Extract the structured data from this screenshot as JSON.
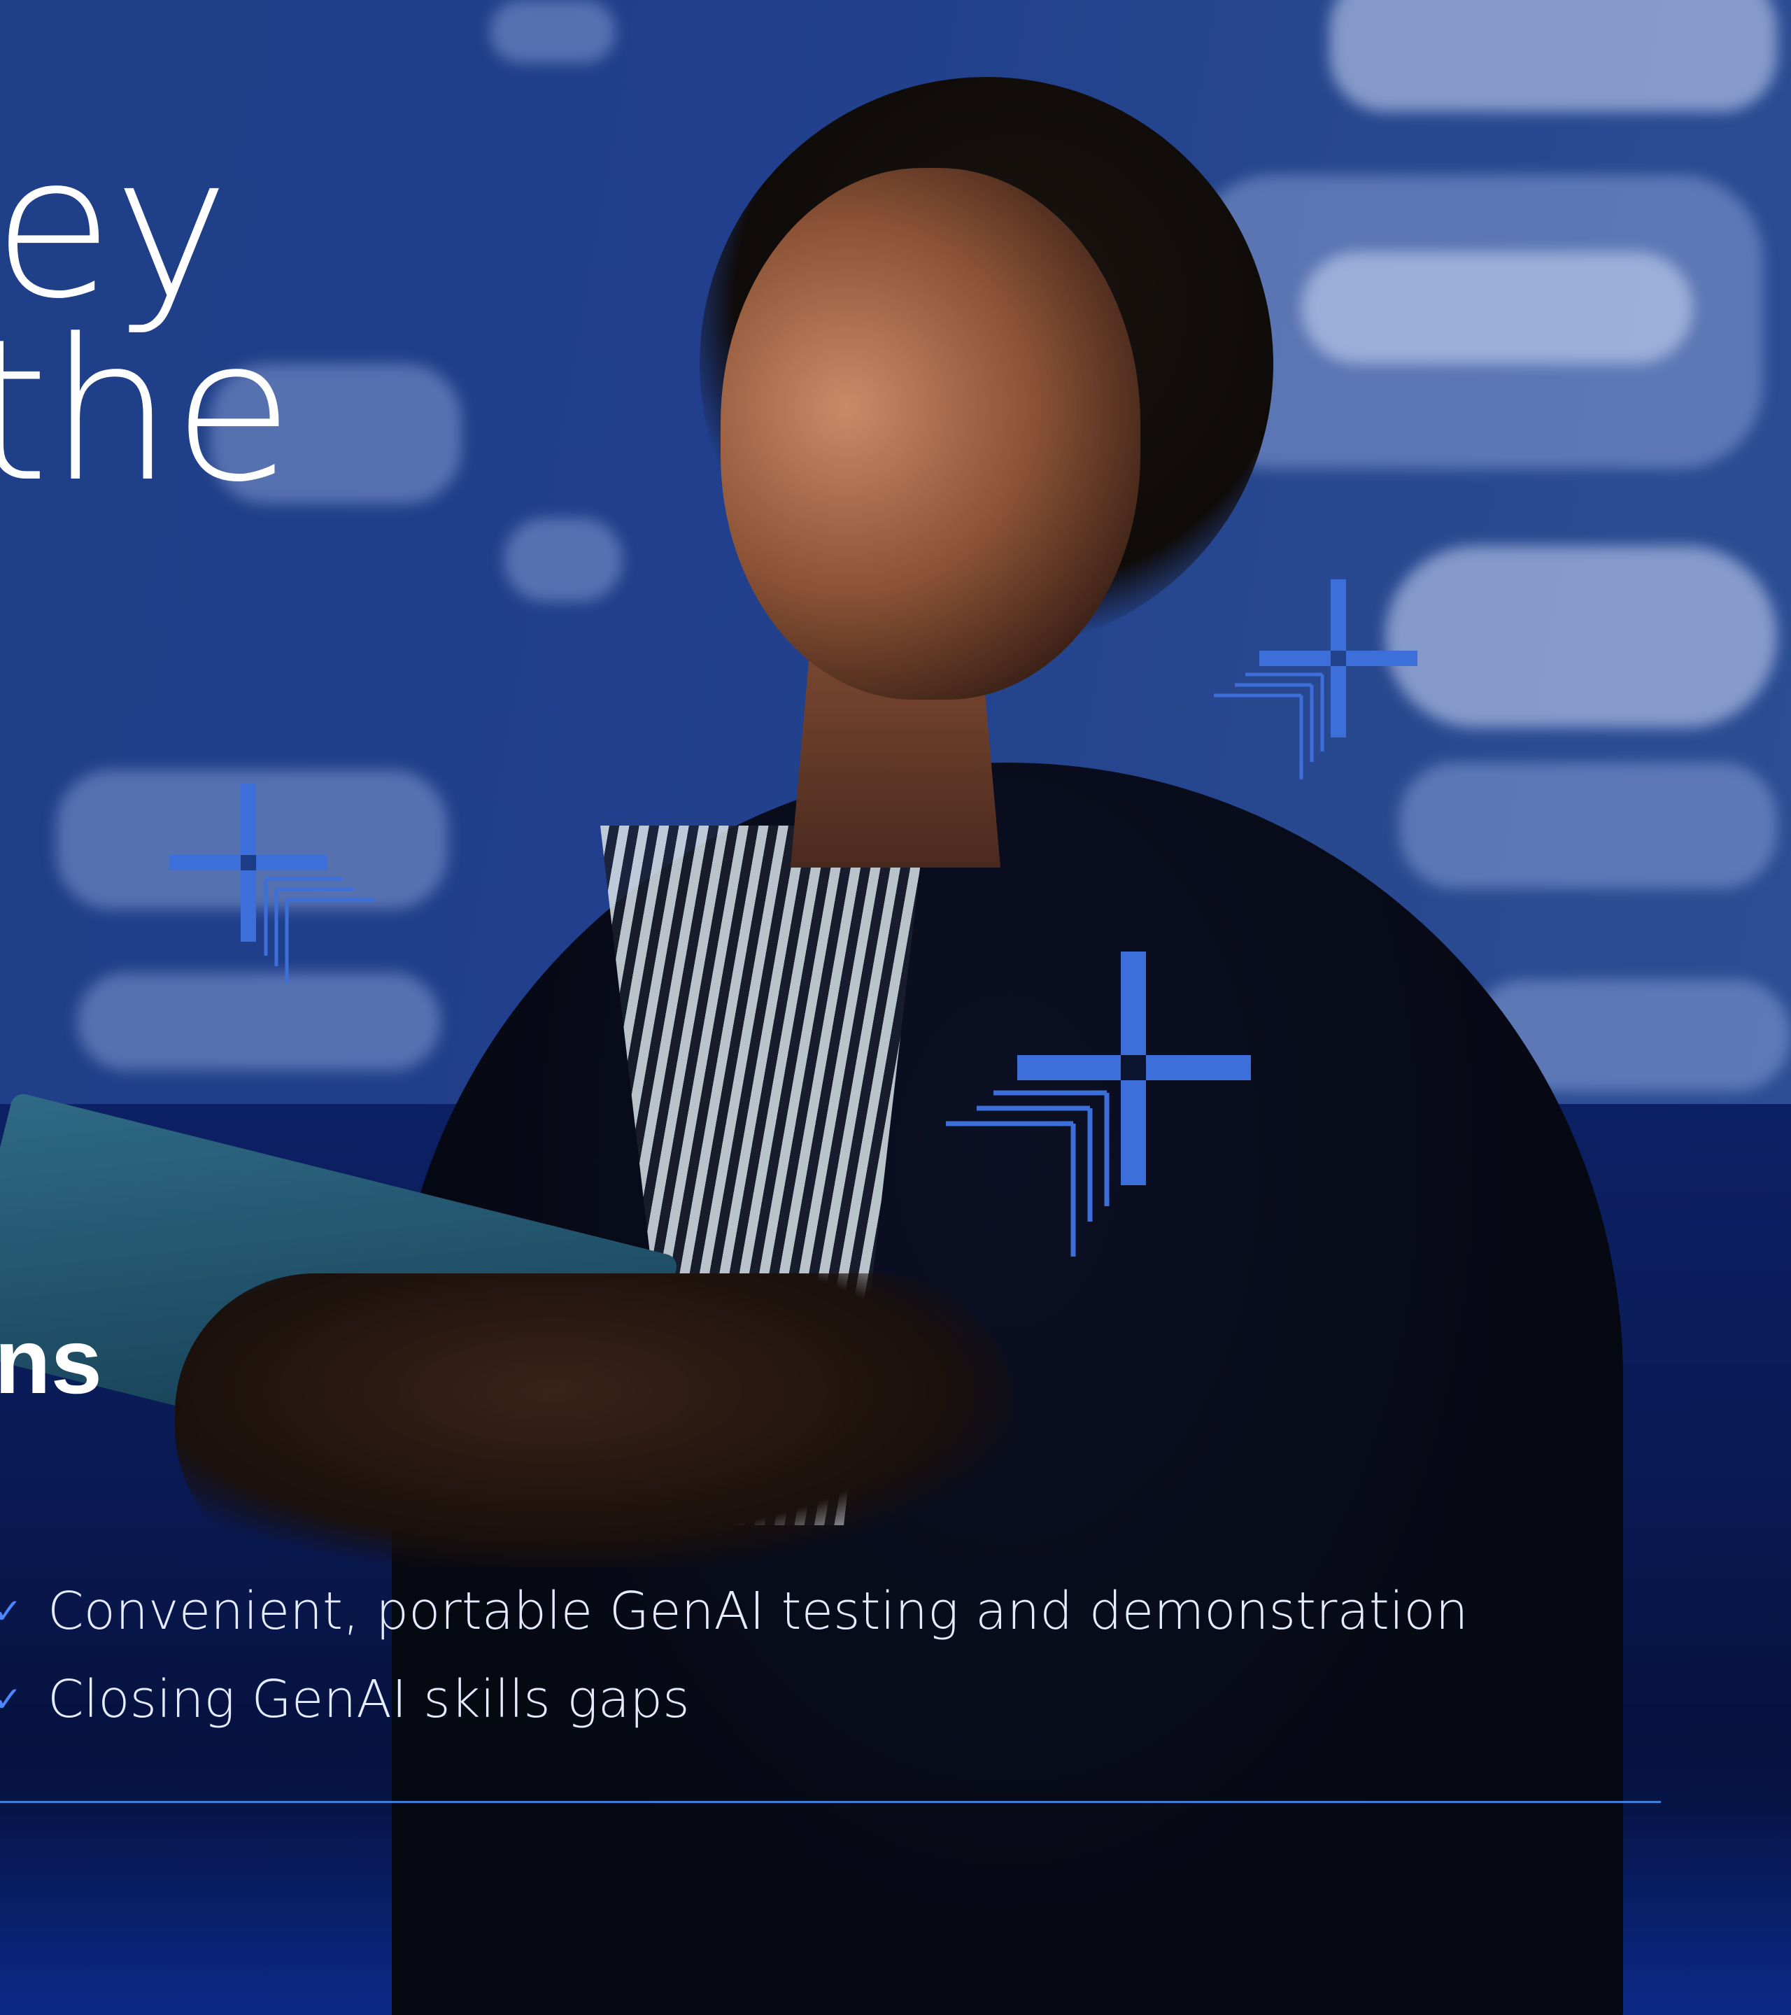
{
  "headline": {
    "line1": "ey",
    "line2": "the"
  },
  "section_title": "ns",
  "bullets": [
    {
      "check_icon": "check-icon",
      "text": "Convenient, portable GenAI testing and demonstration"
    },
    {
      "check_icon": "check-icon",
      "text": "Closing GenAI skills gaps"
    }
  ],
  "colors": {
    "accent": "#3D6FDB",
    "divider": "#3D7ED8",
    "text": "#FFFFFF",
    "background": "#0A1B56"
  },
  "icons": {
    "sparkle": "sparkle-icon"
  }
}
